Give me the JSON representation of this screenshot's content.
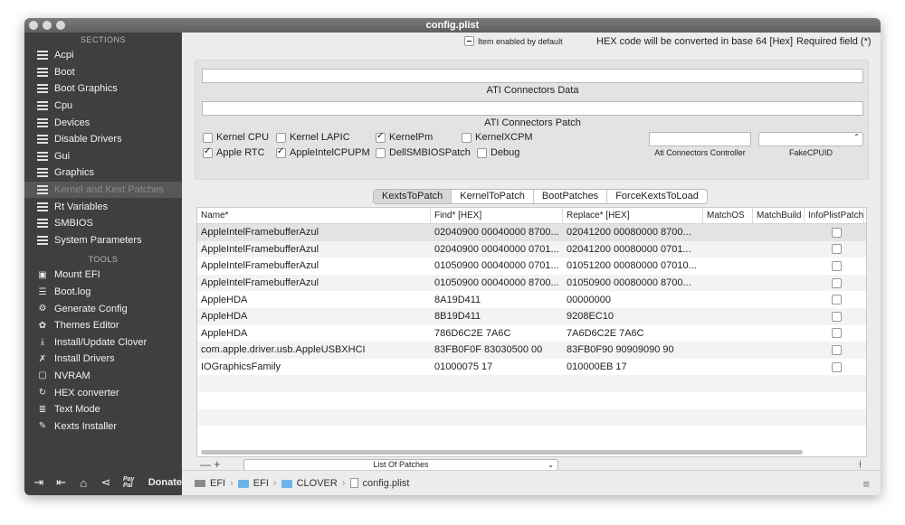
{
  "window": {
    "title": "config.plist"
  },
  "sidebar": {
    "sections_header": "SECTIONS",
    "sections": [
      {
        "label": "Acpi"
      },
      {
        "label": "Boot"
      },
      {
        "label": "Boot Graphics"
      },
      {
        "label": "Cpu"
      },
      {
        "label": "Devices"
      },
      {
        "label": "Disable Drivers"
      },
      {
        "label": "Gui"
      },
      {
        "label": "Graphics"
      },
      {
        "label": "Kernel and Kext Patches",
        "selected": true
      },
      {
        "label": "Rt Variables"
      },
      {
        "label": "SMBIOS"
      },
      {
        "label": "System Parameters"
      }
    ],
    "tools_header": "TOOLS",
    "tools": [
      {
        "label": "Mount EFI",
        "icon": "disk-icon"
      },
      {
        "label": "Boot.log",
        "icon": "log-icon"
      },
      {
        "label": "Generate Config",
        "icon": "gear-icon"
      },
      {
        "label": "Themes Editor",
        "icon": "palette-icon"
      },
      {
        "label": "Install/Update Clover",
        "icon": "download-icon"
      },
      {
        "label": "Install Drivers",
        "icon": "wrench-icon"
      },
      {
        "label": "NVRAM",
        "icon": "chip-icon"
      },
      {
        "label": "HEX converter",
        "icon": "refresh-icon"
      },
      {
        "label": "Text Mode",
        "icon": "text-icon"
      },
      {
        "label": "Kexts Installer",
        "icon": "brush-icon"
      }
    ],
    "bottom": {
      "donate_label": "Donate",
      "paypal_label": "Pay Pal"
    }
  },
  "topinfo": {
    "enabled_default": "Item enabled by default",
    "hex_note": "HEX code will be converted in base 64 [Hex]",
    "required": "Required field (*)"
  },
  "panel": {
    "ati_data_label": "ATI Connectors Data",
    "ati_data_value": "",
    "ati_patch_label": "ATI Connectors Patch",
    "ati_patch_value": "",
    "checkboxes": [
      {
        "label": "Kernel CPU",
        "checked": false
      },
      {
        "label": "Kernel LAPIC",
        "checked": false
      },
      {
        "label": "KernelPm",
        "checked": true
      },
      {
        "label": "KernelXCPM",
        "checked": false
      },
      {
        "label": "Apple RTC",
        "checked": true
      },
      {
        "label": "AppleIntelCPUPM",
        "checked": true
      },
      {
        "label": "DellSMBIOSPatch",
        "checked": false
      },
      {
        "label": "Debug",
        "checked": false
      }
    ],
    "ati_controller_label": "Ati Connectors Controller",
    "ati_controller_value": "",
    "fakecpuid_label": "FakeCPUID",
    "fakecpuid_value": ""
  },
  "tabs": [
    {
      "label": "KextsToPatch",
      "active": true
    },
    {
      "label": "KernelToPatch"
    },
    {
      "label": "BootPatches"
    },
    {
      "label": "ForceKextsToLoad"
    }
  ],
  "table": {
    "headers": [
      "Name*",
      "Find* [HEX]",
      "Replace* [HEX]",
      "MatchOS",
      "MatchBuild",
      "InfoPlistPatch"
    ],
    "rows": [
      {
        "name": "AppleIntelFramebufferAzul",
        "find": "02040900 00040000 8700...",
        "replace": "02041200 00080000 8700...",
        "checked": false
      },
      {
        "name": "AppleIntelFramebufferAzul",
        "find": "02040900 00040000 0701...",
        "replace": "02041200 00080000 0701...",
        "checked": false
      },
      {
        "name": "AppleIntelFramebufferAzul",
        "find": "01050900 00040000 0701...",
        "replace": "01051200 00080000 07010...",
        "checked": false
      },
      {
        "name": "AppleIntelFramebufferAzul",
        "find": "01050900 00040000 8700...",
        "replace": "01050900 00080000 8700...",
        "checked": false
      },
      {
        "name": "AppleHDA",
        "find": "8A19D411",
        "replace": "00000000",
        "checked": false
      },
      {
        "name": "AppleHDA",
        "find": "8B19D411",
        "replace": "9208EC10",
        "checked": false
      },
      {
        "name": "AppleHDA",
        "find": "786D6C2E 7A6C",
        "replace": "7A6D6C2E 7A6C",
        "checked": false
      },
      {
        "name": "com.apple.driver.usb.AppleUSBXHCI",
        "find": "83FB0F0F 83030500 00",
        "replace": "83FB0F90 90909090 90",
        "checked": false
      },
      {
        "name": "IOGraphicsFamily",
        "find": "01000075 17",
        "replace": "010000EB 17",
        "checked": false
      }
    ]
  },
  "footer": {
    "minus": "—",
    "plus": "+",
    "list_select": "List Of Patches"
  },
  "pathbar": {
    "items": [
      "EFI",
      "EFI",
      "CLOVER",
      "config.plist"
    ]
  }
}
